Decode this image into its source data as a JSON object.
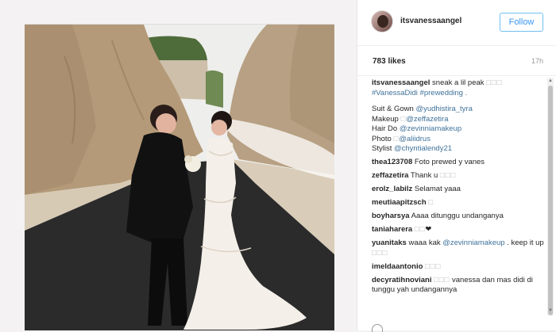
{
  "post": {
    "username": "itsvanessaangel",
    "follow_label": "Follow",
    "likes": "783 likes",
    "age": "17h",
    "caption_lines": [
      {
        "user": "itsvanessaangel",
        "text": " sneak a lil peak ",
        "glyph": "□□□"
      },
      {
        "text": "#VanessaDidi #prewedding .",
        "blue": true
      },
      {
        "text": ""
      },
      {
        "prefix": "Suit & Gown ",
        "link": "@yudhistira_tyra"
      },
      {
        "prefix": "Makeup ",
        "glyph": "□",
        "link": "@zeffazetira"
      },
      {
        "prefix": "Hair Do ",
        "link": "@zevinniamakeup"
      },
      {
        "prefix": "Photo ",
        "glyph": "□",
        "link": "@aliidrus"
      },
      {
        "prefix": "Stylist ",
        "link": "@chyntialendy21"
      }
    ],
    "comments": [
      {
        "user": "thea123708",
        "text": " Foto prewed y vanes"
      },
      {
        "user": "zeffazetira",
        "text": " Thank u ",
        "glyph": "□□□"
      },
      {
        "user": "erolz_labilz",
        "text": " Selamat yaaa"
      },
      {
        "user": "meutiaapitzsch",
        "text": " ",
        "glyph": "□"
      },
      {
        "user": "boyharsya",
        "text": " Aaaa ditunggu undanganya"
      },
      {
        "user": "taniaharera",
        "text": " ",
        "glyph": "□□",
        "heart": "❤"
      },
      {
        "user": "yuanitaks",
        "text": " waaa kak ",
        "link": "@zevinniamakeup",
        "text2": " . keep it up ",
        "glyph2": "□□□",
        "wrap": true
      },
      {
        "user": "imeldaantonio",
        "text": " ",
        "glyph": "□□□"
      },
      {
        "user": "decyratihnoviani",
        "text": " ",
        "glyph": "□□□",
        "text2": " vanessa dan mas didi di tunggu yah undangannya",
        "wrap": true
      }
    ]
  },
  "colors": {
    "link": "#3f729b",
    "follow_border": "#70c0ef",
    "follow_text": "#3897f0"
  }
}
